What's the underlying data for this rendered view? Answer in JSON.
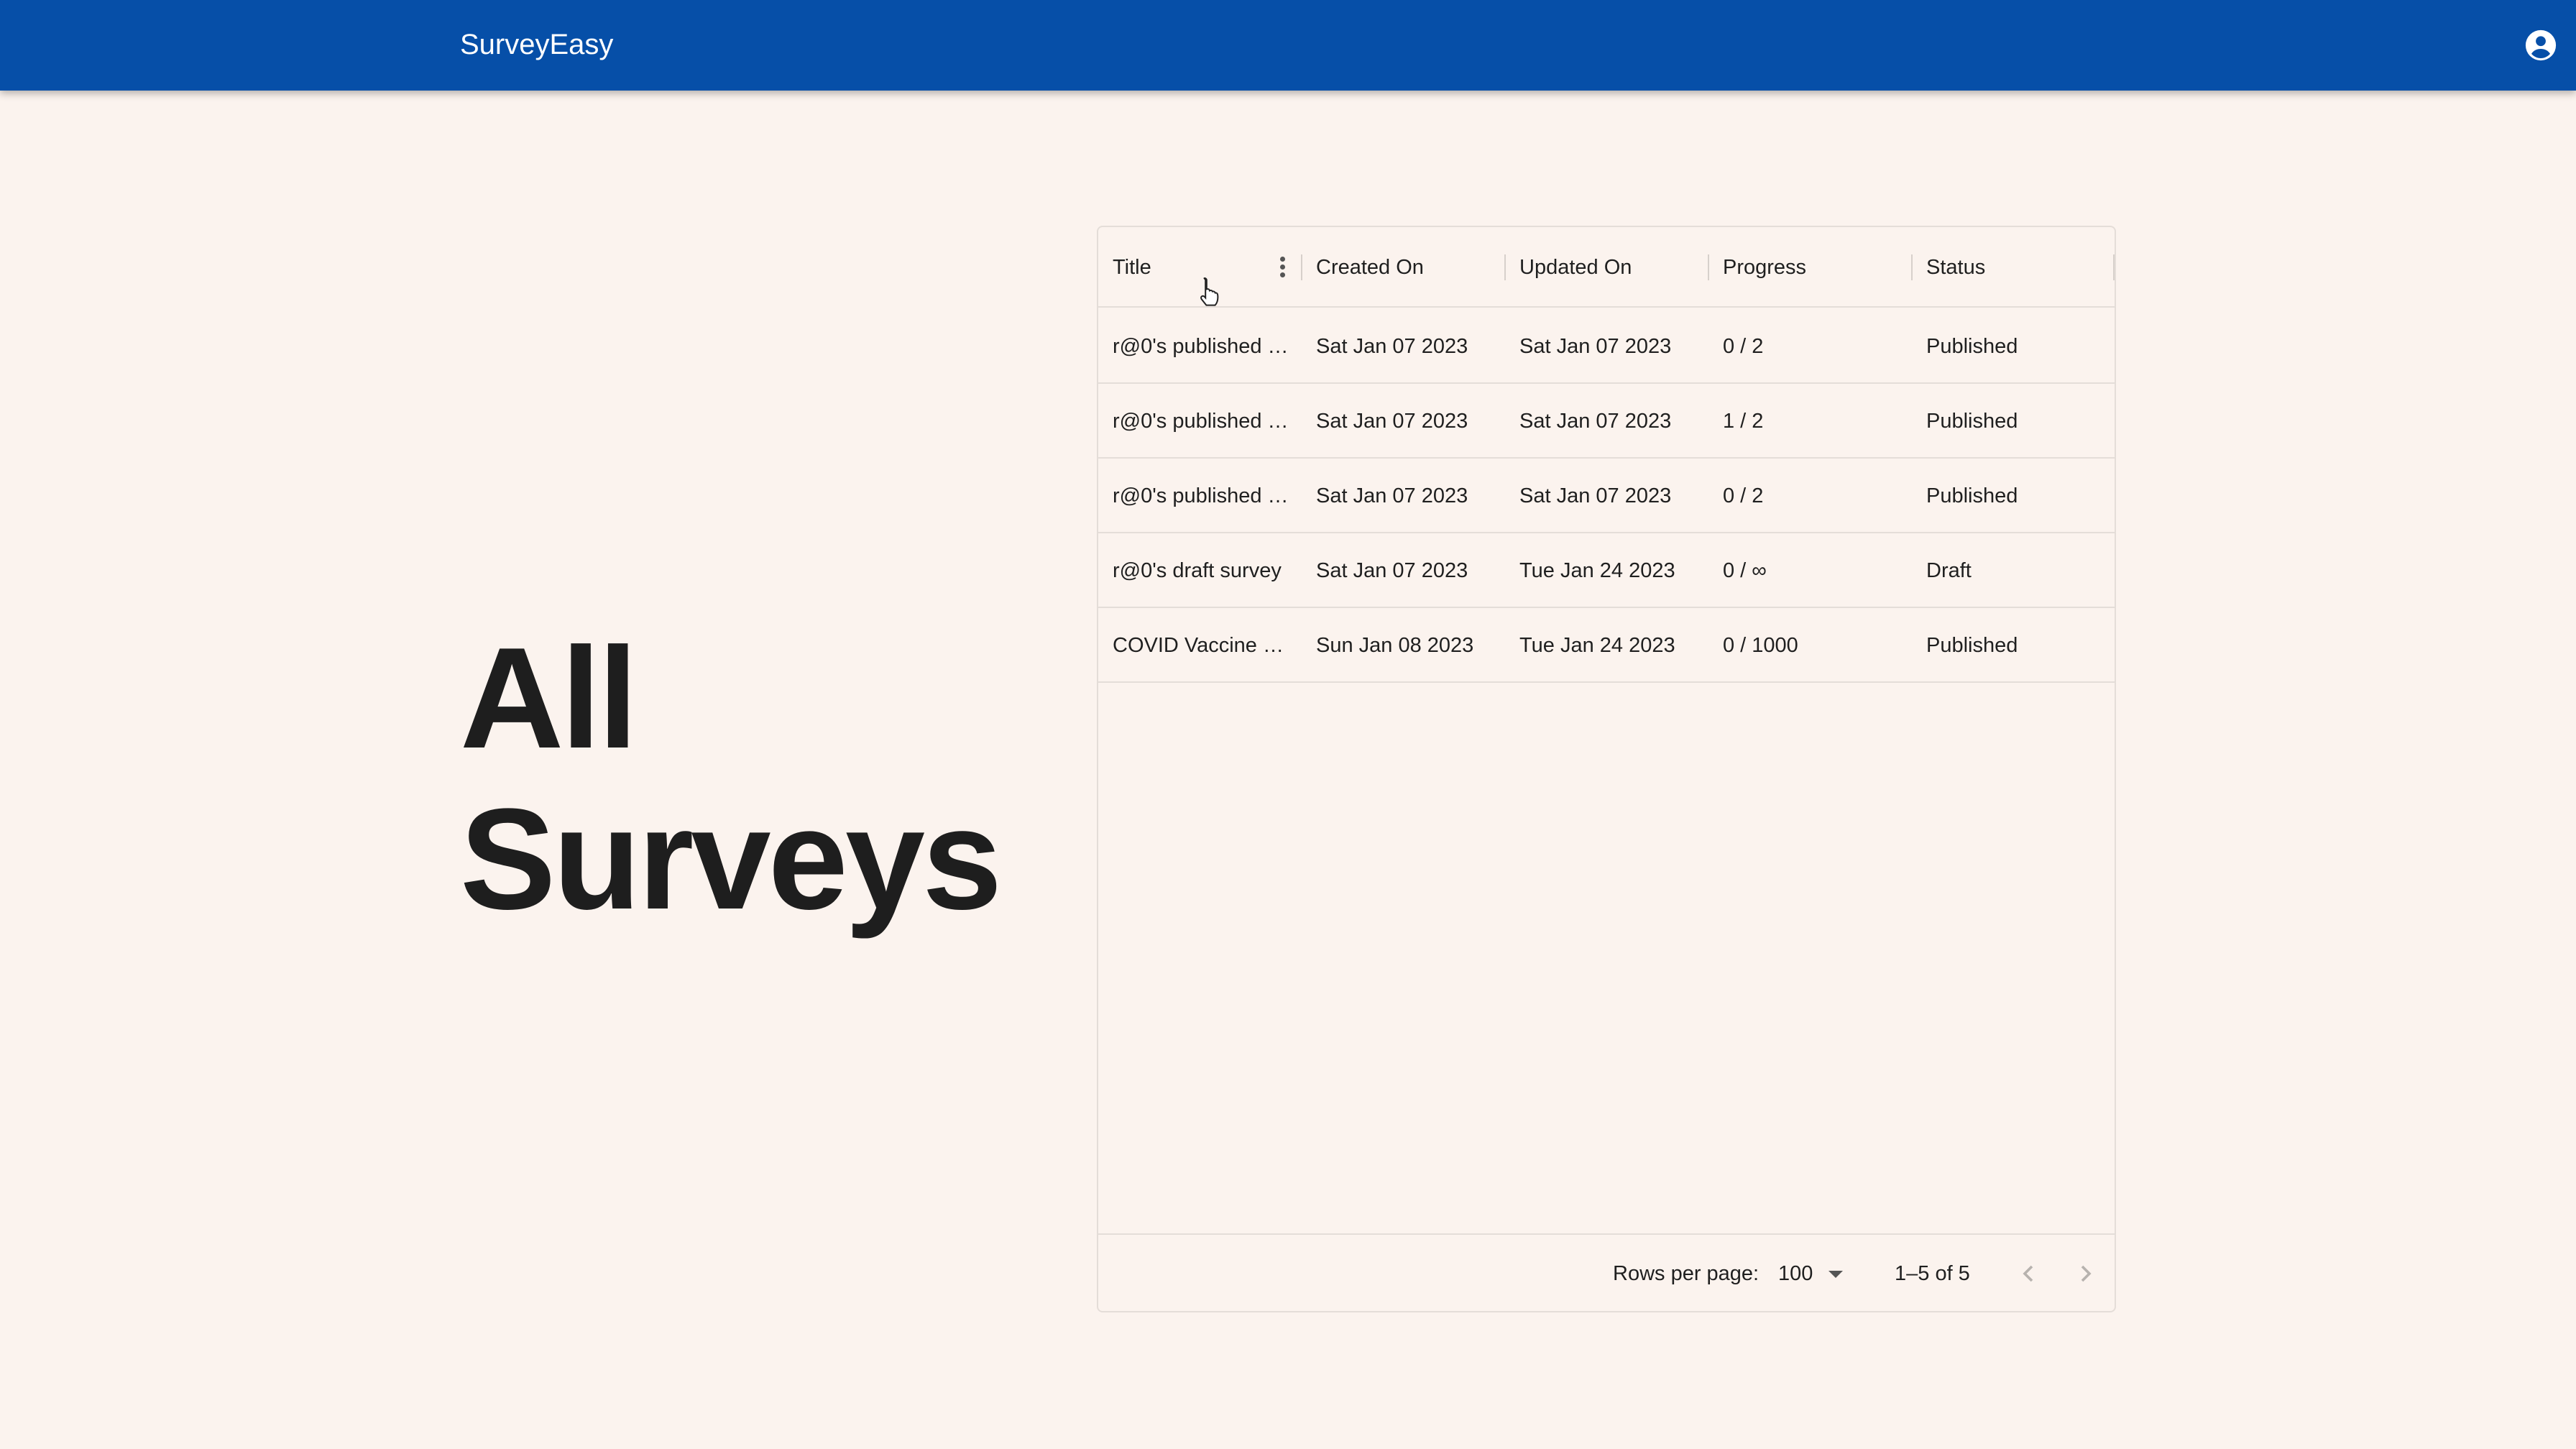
{
  "appbar": {
    "brand": "SurveyEasy",
    "account_icon": "account-circle-icon"
  },
  "hero": {
    "line1": "All",
    "line2": "Surveys"
  },
  "table": {
    "columns": [
      "Title",
      "Created On",
      "Updated On",
      "Progress",
      "Status"
    ],
    "column_menu_icon": "more-vert-icon",
    "rows": [
      {
        "title": "r@0's published …",
        "created": "Sat Jan 07 2023",
        "updated": "Sat Jan 07 2023",
        "progress": "0 / 2",
        "status": "Published"
      },
      {
        "title": "r@0's published …",
        "created": "Sat Jan 07 2023",
        "updated": "Sat Jan 07 2023",
        "progress": "1 / 2",
        "status": "Published"
      },
      {
        "title": "r@0's published …",
        "created": "Sat Jan 07 2023",
        "updated": "Sat Jan 07 2023",
        "progress": "0 / 2",
        "status": "Published"
      },
      {
        "title": "r@0's draft survey",
        "created": "Sat Jan 07 2023",
        "updated": "Tue Jan 24 2023",
        "progress": "0 / ∞",
        "status": "Draft"
      },
      {
        "title": "COVID Vaccine …",
        "created": "Sun Jan 08 2023",
        "updated": "Tue Jan 24 2023",
        "progress": "0 / 1000",
        "status": "Published"
      }
    ]
  },
  "pagination": {
    "rows_per_page_label": "Rows per page:",
    "rows_per_page_value": "100",
    "range_text": "1–5 of 5",
    "prev_icon": "chevron-left-icon",
    "next_icon": "chevron-right-icon"
  },
  "colors": {
    "appbar": "#064fa8",
    "background": "#fbf3ee",
    "border": "#e4ddd8"
  }
}
